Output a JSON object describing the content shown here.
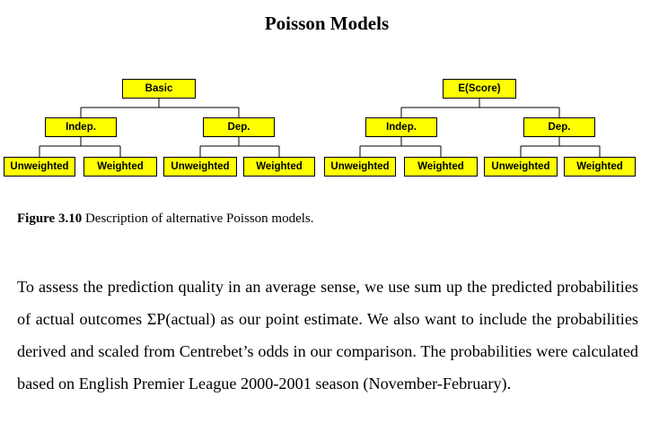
{
  "title": "Poisson Models",
  "diagram": {
    "trees": [
      {
        "root": "Basic",
        "branches": [
          {
            "label": "Indep.",
            "leaves": [
              "Unweighted",
              "Weighted"
            ]
          },
          {
            "label": "Dep.",
            "leaves": [
              "Unweighted",
              "Weighted"
            ]
          }
        ]
      },
      {
        "root": "E(Score)",
        "branches": [
          {
            "label": "Indep.",
            "leaves": [
              "Unweighted",
              "Weighted"
            ]
          },
          {
            "label": "Dep.",
            "leaves": [
              "Unweighted",
              "Weighted"
            ]
          }
        ]
      }
    ],
    "box_color": "#ffff00"
  },
  "caption": {
    "figure_label": "Figure 3.10",
    "text": " Description of alternative Poisson models."
  },
  "body_text": "To assess the prediction quality in an average sense, we use sum up the predicted probabilities of actual outcomes ΣP(actual) as our point estimate.  We also want to include the probabilities derived and scaled from Centrebet’s odds in our comparison.  The probabilities were calculated based on English Premier League 2000-2001 season (November-February)."
}
